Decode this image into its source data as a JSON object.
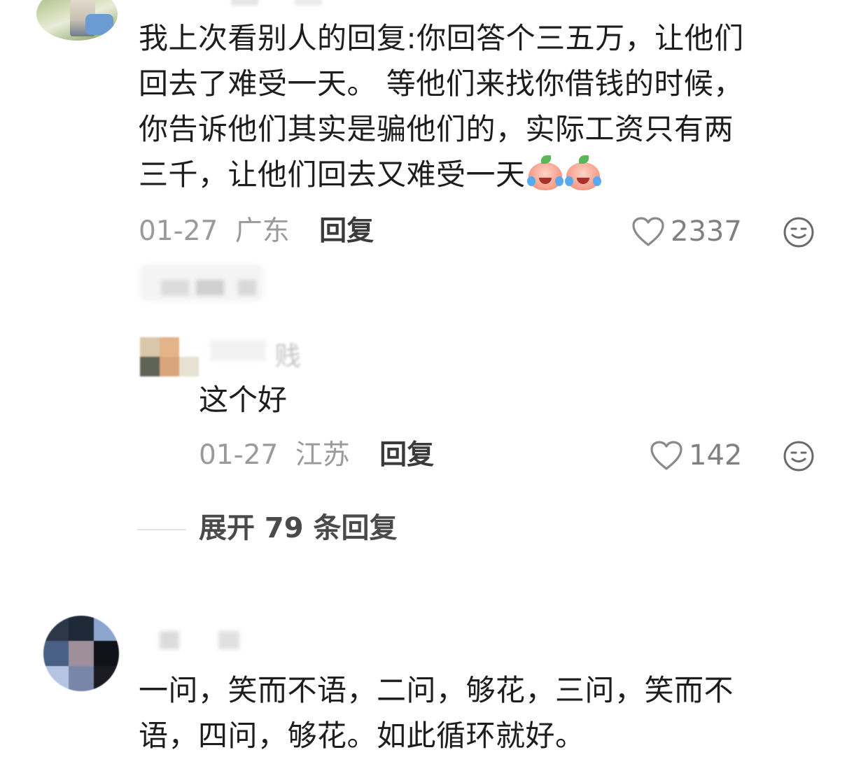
{
  "comment1": {
    "text_lines": [
      "我上次看别人的回复:你回答个三五万，让他们",
      "回去了难受一天。 等他们来找你借钱的时候，",
      "你告诉他们其实是骗他们的，实际工资只有两",
      "三千，让他们回去又难受一天"
    ],
    "emoji_names": [
      "crying-laughing-peach-emoji",
      "crying-laughing-peach-emoji"
    ],
    "date": "01-27",
    "location": "广东",
    "reply_label": "回复",
    "like_count": "2337"
  },
  "reply1": {
    "name_visible_fragment": "贱",
    "text": "这个好",
    "date": "01-27",
    "location": "江苏",
    "reply_label": "回复",
    "like_count": "142"
  },
  "expand": {
    "label": "展开 79 条回复"
  },
  "comment2": {
    "text_lines": [
      "一问，笑而不语，二问，够花，三问，笑而不",
      "语，四问，够花。如此循环就好。"
    ]
  },
  "colors": {
    "text": "#1d1d1d",
    "meta": "#9a9a9a",
    "like": "#808080",
    "emoji_face": "#f59a86",
    "emoji_tear": "#5aa9f0"
  }
}
